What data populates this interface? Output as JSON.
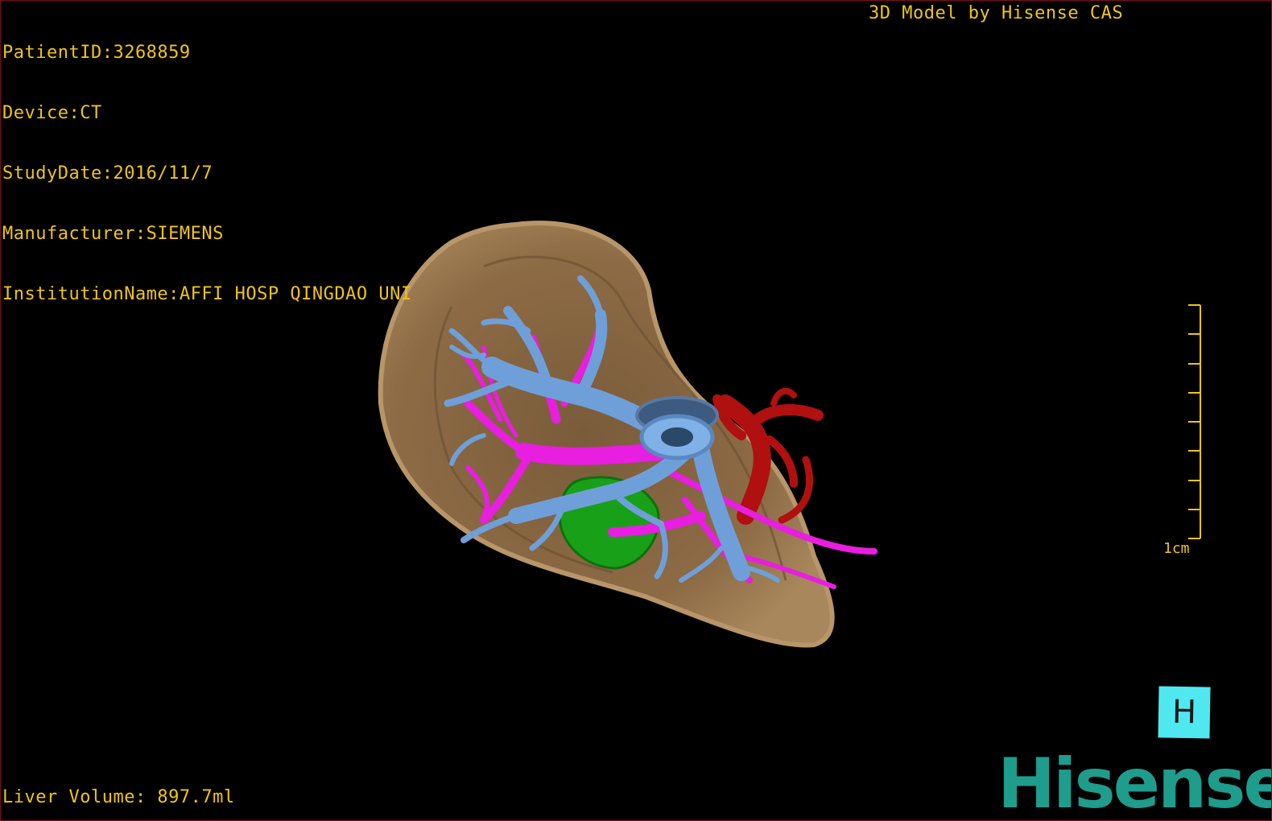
{
  "overlay": {
    "patient_id": "PatientID:3268859",
    "device": "Device:CT",
    "study_date": "StudyDate:2016/11/7",
    "manufacturer": "Manufacturer:SIEMENS",
    "institution": "InstitutionName:AFFI HOSP QINGDAO UNI",
    "credit": "3D Model by Hisense CAS",
    "liver_volume": "Liver Volume: 897.7ml"
  },
  "scale_bar": {
    "label": "1cm"
  },
  "orientation_marker": {
    "label": "H"
  },
  "logo": {
    "text": "Hisense"
  },
  "colors": {
    "overlay_text": "#f0c419",
    "liver": "#8a6a45",
    "hepatic_vein": "#6f9fd8",
    "portal_vein": "#e81ee0",
    "artery": "#b01010",
    "gallbladder": "#18a018",
    "orientation_marker_bg": "#4fe8f0",
    "logo": "#1e9c8c"
  }
}
